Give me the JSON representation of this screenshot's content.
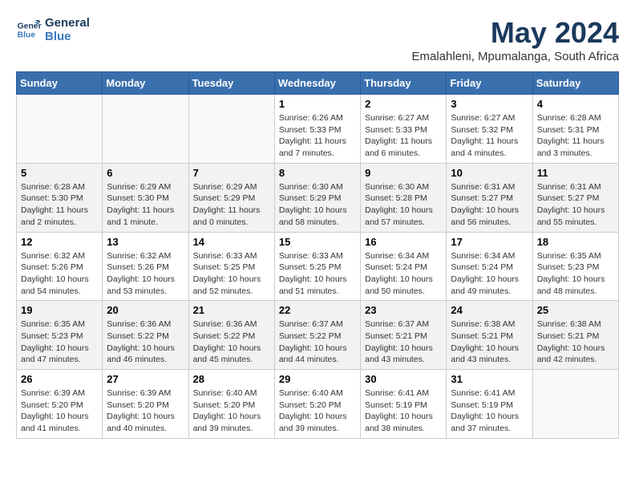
{
  "header": {
    "logo_line1": "General",
    "logo_line2": "Blue",
    "month": "May 2024",
    "location": "Emalahleni, Mpumalanga, South Africa"
  },
  "weekdays": [
    "Sunday",
    "Monday",
    "Tuesday",
    "Wednesday",
    "Thursday",
    "Friday",
    "Saturday"
  ],
  "weeks": [
    [
      {
        "day": "",
        "info": ""
      },
      {
        "day": "",
        "info": ""
      },
      {
        "day": "",
        "info": ""
      },
      {
        "day": "1",
        "info": "Sunrise: 6:26 AM\nSunset: 5:33 PM\nDaylight: 11 hours\nand 7 minutes."
      },
      {
        "day": "2",
        "info": "Sunrise: 6:27 AM\nSunset: 5:33 PM\nDaylight: 11 hours\nand 6 minutes."
      },
      {
        "day": "3",
        "info": "Sunrise: 6:27 AM\nSunset: 5:32 PM\nDaylight: 11 hours\nand 4 minutes."
      },
      {
        "day": "4",
        "info": "Sunrise: 6:28 AM\nSunset: 5:31 PM\nDaylight: 11 hours\nand 3 minutes."
      }
    ],
    [
      {
        "day": "5",
        "info": "Sunrise: 6:28 AM\nSunset: 5:30 PM\nDaylight: 11 hours\nand 2 minutes."
      },
      {
        "day": "6",
        "info": "Sunrise: 6:29 AM\nSunset: 5:30 PM\nDaylight: 11 hours\nand 1 minute."
      },
      {
        "day": "7",
        "info": "Sunrise: 6:29 AM\nSunset: 5:29 PM\nDaylight: 11 hours\nand 0 minutes."
      },
      {
        "day": "8",
        "info": "Sunrise: 6:30 AM\nSunset: 5:29 PM\nDaylight: 10 hours\nand 58 minutes."
      },
      {
        "day": "9",
        "info": "Sunrise: 6:30 AM\nSunset: 5:28 PM\nDaylight: 10 hours\nand 57 minutes."
      },
      {
        "day": "10",
        "info": "Sunrise: 6:31 AM\nSunset: 5:27 PM\nDaylight: 10 hours\nand 56 minutes."
      },
      {
        "day": "11",
        "info": "Sunrise: 6:31 AM\nSunset: 5:27 PM\nDaylight: 10 hours\nand 55 minutes."
      }
    ],
    [
      {
        "day": "12",
        "info": "Sunrise: 6:32 AM\nSunset: 5:26 PM\nDaylight: 10 hours\nand 54 minutes."
      },
      {
        "day": "13",
        "info": "Sunrise: 6:32 AM\nSunset: 5:26 PM\nDaylight: 10 hours\nand 53 minutes."
      },
      {
        "day": "14",
        "info": "Sunrise: 6:33 AM\nSunset: 5:25 PM\nDaylight: 10 hours\nand 52 minutes."
      },
      {
        "day": "15",
        "info": "Sunrise: 6:33 AM\nSunset: 5:25 PM\nDaylight: 10 hours\nand 51 minutes."
      },
      {
        "day": "16",
        "info": "Sunrise: 6:34 AM\nSunset: 5:24 PM\nDaylight: 10 hours\nand 50 minutes."
      },
      {
        "day": "17",
        "info": "Sunrise: 6:34 AM\nSunset: 5:24 PM\nDaylight: 10 hours\nand 49 minutes."
      },
      {
        "day": "18",
        "info": "Sunrise: 6:35 AM\nSunset: 5:23 PM\nDaylight: 10 hours\nand 48 minutes."
      }
    ],
    [
      {
        "day": "19",
        "info": "Sunrise: 6:35 AM\nSunset: 5:23 PM\nDaylight: 10 hours\nand 47 minutes."
      },
      {
        "day": "20",
        "info": "Sunrise: 6:36 AM\nSunset: 5:22 PM\nDaylight: 10 hours\nand 46 minutes."
      },
      {
        "day": "21",
        "info": "Sunrise: 6:36 AM\nSunset: 5:22 PM\nDaylight: 10 hours\nand 45 minutes."
      },
      {
        "day": "22",
        "info": "Sunrise: 6:37 AM\nSunset: 5:22 PM\nDaylight: 10 hours\nand 44 minutes."
      },
      {
        "day": "23",
        "info": "Sunrise: 6:37 AM\nSunset: 5:21 PM\nDaylight: 10 hours\nand 43 minutes."
      },
      {
        "day": "24",
        "info": "Sunrise: 6:38 AM\nSunset: 5:21 PM\nDaylight: 10 hours\nand 43 minutes."
      },
      {
        "day": "25",
        "info": "Sunrise: 6:38 AM\nSunset: 5:21 PM\nDaylight: 10 hours\nand 42 minutes."
      }
    ],
    [
      {
        "day": "26",
        "info": "Sunrise: 6:39 AM\nSunset: 5:20 PM\nDaylight: 10 hours\nand 41 minutes."
      },
      {
        "day": "27",
        "info": "Sunrise: 6:39 AM\nSunset: 5:20 PM\nDaylight: 10 hours\nand 40 minutes."
      },
      {
        "day": "28",
        "info": "Sunrise: 6:40 AM\nSunset: 5:20 PM\nDaylight: 10 hours\nand 39 minutes."
      },
      {
        "day": "29",
        "info": "Sunrise: 6:40 AM\nSunset: 5:20 PM\nDaylight: 10 hours\nand 39 minutes."
      },
      {
        "day": "30",
        "info": "Sunrise: 6:41 AM\nSunset: 5:19 PM\nDaylight: 10 hours\nand 38 minutes."
      },
      {
        "day": "31",
        "info": "Sunrise: 6:41 AM\nSunset: 5:19 PM\nDaylight: 10 hours\nand 37 minutes."
      },
      {
        "day": "",
        "info": ""
      }
    ]
  ]
}
